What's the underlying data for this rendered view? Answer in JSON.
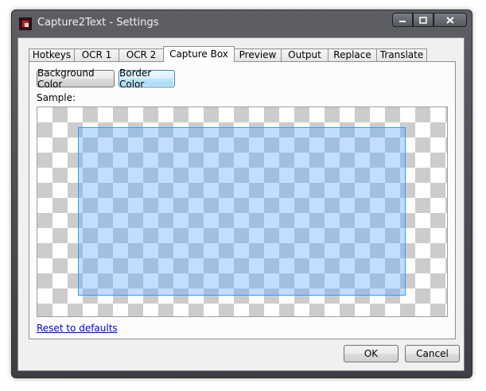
{
  "window": {
    "title": "Capture2Text - Settings",
    "caption_buttons": [
      "minimize-icon",
      "maximize-icon",
      "close-icon"
    ]
  },
  "tabs": [
    {
      "label": "Hotkeys",
      "active": false
    },
    {
      "label": "OCR 1",
      "active": false
    },
    {
      "label": "OCR 2",
      "active": false
    },
    {
      "label": "Capture Box",
      "active": true
    },
    {
      "label": "Preview",
      "active": false
    },
    {
      "label": "Output",
      "active": false
    },
    {
      "label": "Replace",
      "active": false
    },
    {
      "label": "Translate",
      "active": false
    }
  ],
  "capture_box": {
    "background_color_label": "Background Color",
    "border_color_label": "Border Color",
    "sample_label": "Sample:",
    "sample_fill_color": "#66aaff",
    "sample_border_color": "#3399ff",
    "reset_link": "Reset to defaults"
  },
  "footer": {
    "ok_label": "OK",
    "cancel_label": "Cancel"
  }
}
